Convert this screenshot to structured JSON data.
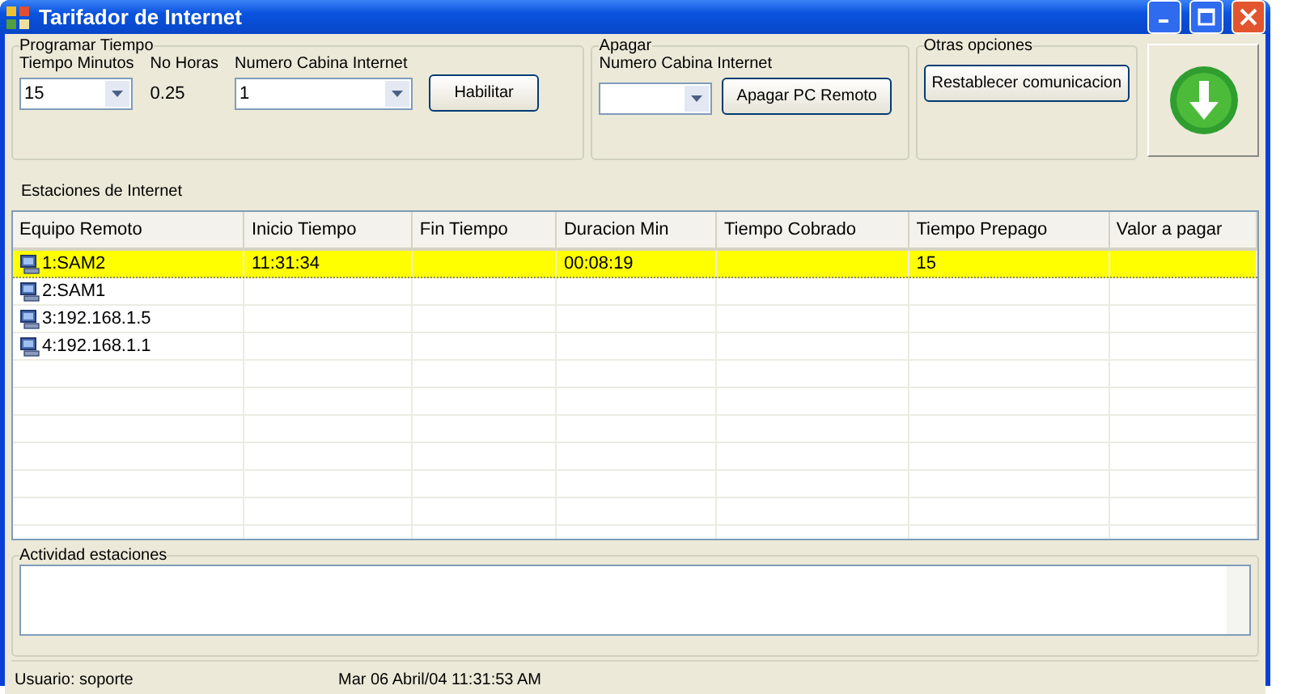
{
  "window": {
    "title": "Tarifador de Internet"
  },
  "programar": {
    "legend": "Programar Tiempo",
    "minutes_label": "Tiempo Minutos",
    "minutes": "15",
    "hours_label": "No Horas",
    "hours": "0.25",
    "cabin_label": "Numero Cabina Internet",
    "cabin": "1",
    "button": "Habilitar"
  },
  "apagar": {
    "legend": "Apagar",
    "cabin_label": "Numero Cabina Internet",
    "button": "Apagar PC Remoto"
  },
  "otras": {
    "legend": "Otras opciones",
    "button": "Restablecer comunicacion"
  },
  "stations": {
    "label": "Estaciones de Internet",
    "columns": [
      "Equipo Remoto",
      "Inicio Tiempo",
      "Fin Tiempo",
      "Duracion Min",
      "Tiempo Cobrado",
      "Tiempo Prepago",
      "Valor a pagar"
    ],
    "rows": [
      {
        "cells": [
          "1:SAM2",
          "11:31:34",
          null,
          "00:08:19",
          null,
          "15",
          null
        ],
        "selected": true
      },
      {
        "cells": [
          "2:SAM1",
          null,
          null,
          null,
          null,
          null,
          null
        ],
        "selected": false
      },
      {
        "cells": [
          "3:192.168.1.5",
          null,
          null,
          null,
          null,
          null,
          null
        ],
        "selected": false
      },
      {
        "cells": [
          "4:192.168.1.1",
          null,
          null,
          null,
          null,
          null,
          null
        ],
        "selected": false
      }
    ]
  },
  "activity": {
    "legend": "Actividad estaciones"
  },
  "status_bar": [
    "Usuario: soporte",
    "Mar 06 Abril/04 11:31:53 AM"
  ]
}
